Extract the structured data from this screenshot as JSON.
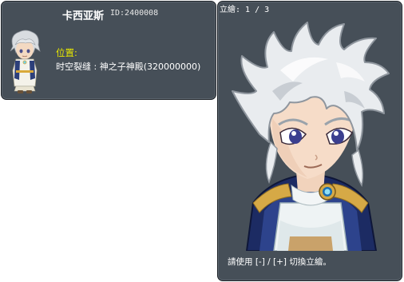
{
  "npc": {
    "name": "卡西亚斯",
    "id_text": "ID:2400008",
    "location_label": "位置:",
    "location_value": "时空裂缝 : 神之子神殿(320000000)"
  },
  "portrait_viewer": {
    "pager_text": "立繪: 1 / 3",
    "hint_text": "請使用 [-] / [+] 切換立繪。"
  },
  "colors": {
    "panel_bg": "#464f58",
    "panel_border": "#1b2026",
    "label_yellow": "#e8e800",
    "text_white": "#ffffff"
  },
  "icons": {
    "sprite": "npc-chibi-sprite",
    "portrait": "npc-portrait-illustration"
  }
}
